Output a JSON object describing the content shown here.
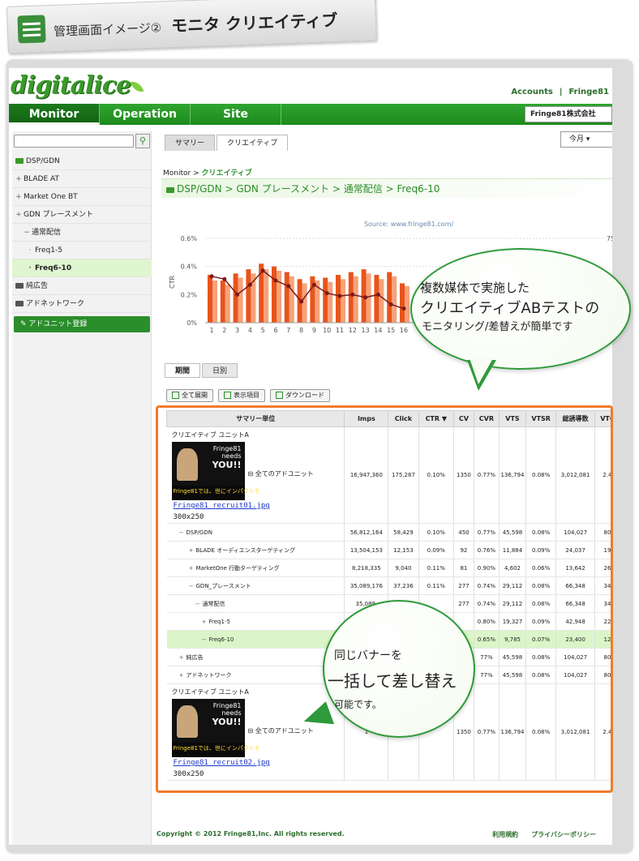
{
  "banner": {
    "prefix": "管理画面イメージ②",
    "title": "モニタ クリエイティブ"
  },
  "logo": "digitalice",
  "account_links": [
    "Accounts",
    "|",
    "Fringe81"
  ],
  "nav": [
    "Monitor",
    "Operation",
    "Site"
  ],
  "company": "Fringe81株式会社",
  "sidebar": {
    "items": [
      {
        "label": "DSP/GDN",
        "kind": "folder-green"
      },
      {
        "label": "BLADE AT",
        "kind": "plus"
      },
      {
        "label": "Market One BT",
        "kind": "plus"
      },
      {
        "label": "GDN プレースメント",
        "kind": "plus"
      },
      {
        "label": "通常配信",
        "kind": "minus"
      },
      {
        "label": "Freq1-5",
        "kind": "dot"
      },
      {
        "label": "Freq6-10",
        "kind": "dot-sel"
      },
      {
        "label": "純広告",
        "kind": "folder"
      },
      {
        "label": "アドネットワーク",
        "kind": "folder"
      }
    ],
    "register": "アドユニット登録"
  },
  "main_tabs": [
    "サマリー",
    "クリエイティブ"
  ],
  "period": "今月",
  "breadcrumb": {
    "root": "Monitor >",
    "current": "クリエイティブ"
  },
  "path": [
    "DSP/GDN",
    "GDN プレースメント",
    "通常配信",
    "Freq6-10"
  ],
  "chart_data": {
    "type": "bar",
    "source": "Source: www.fringe81.com/",
    "ylabel": "CTR",
    "yticks": [
      "0%",
      "0.2%",
      "0.4%",
      "0.6%"
    ],
    "ylim": [
      0,
      0.6
    ],
    "right_tick": "75",
    "categories": [
      "1",
      "2",
      "3",
      "4",
      "5",
      "6",
      "7",
      "8",
      "9",
      "10",
      "11",
      "12",
      "13",
      "14",
      "15",
      "16"
    ],
    "series": [
      {
        "values": [
          0.34,
          0.3,
          0.35,
          0.38,
          0.42,
          0.4,
          0.36,
          0.31,
          0.33,
          0.32,
          0.34,
          0.36,
          0.38,
          0.34,
          0.36,
          0.28
        ]
      },
      {
        "values": [
          0.3,
          0.27,
          0.32,
          0.35,
          0.38,
          0.37,
          0.33,
          0.28,
          0.3,
          0.29,
          0.31,
          0.33,
          0.35,
          0.31,
          0.33,
          0.26
        ]
      }
    ],
    "line": [
      0.33,
      0.31,
      0.2,
      0.27,
      0.37,
      0.3,
      0.26,
      0.15,
      0.27,
      0.21,
      0.19,
      0.2,
      0.18,
      0.2,
      0.13,
      0.1
    ]
  },
  "period_tabs": [
    "期間",
    "日別"
  ],
  "tools": [
    "全て展開",
    "表示項目",
    "ダウンロード"
  ],
  "table": {
    "headers": [
      "サマリー単位",
      "Imps",
      "Click",
      "CTR ▼",
      "CV",
      "CVR",
      "VTS",
      "VTSR",
      "総誘導数",
      "VTC"
    ],
    "creative1": {
      "label": "クリエイティブ ユニットA",
      "file": "Fringe81_recruit01.jpg",
      "size": "300x250",
      "unit": "全てのアドユニット",
      "values": [
        "16,947,360",
        "175,287",
        "0.10%",
        "1350",
        "0.77%",
        "136,794",
        "0.08%",
        "3,012,081",
        "2.4"
      ]
    },
    "rows": [
      {
        "name": "DSP/GDN",
        "pm": "−",
        "values": [
          "56,812,164",
          "58,429",
          "0.10%",
          "450",
          "0.77%",
          "45,598",
          "0.08%",
          "104,027",
          "80"
        ]
      },
      {
        "name": "BLADE オーディエンスターゲティング",
        "pm": "+",
        "values": [
          "13,504,153",
          "12,153",
          "0.09%",
          "92",
          "0.76%",
          "11,884",
          "0.09%",
          "24,037",
          "19"
        ]
      },
      {
        "name": "MarketOne 行動ターゲティング",
        "pm": "+",
        "values": [
          "8,218,335",
          "9,040",
          "0.11%",
          "81",
          "0.90%",
          "4,602",
          "0.06%",
          "13,642",
          "26"
        ]
      },
      {
        "name": "GDN_プレースメント",
        "pm": "−",
        "values": [
          "35,089,176",
          "37,236",
          "0.11%",
          "277",
          "0.74%",
          "29,112",
          "0.08%",
          "66,348",
          "34"
        ]
      },
      {
        "name": "通常配信",
        "pm": "−",
        "values": [
          "35,089,",
          "",
          "",
          "277",
          "0.74%",
          "29,112",
          "0.08%",
          "66,348",
          "34"
        ]
      },
      {
        "name": "Freq1-5",
        "pm": "+",
        "values": [
          "",
          "",
          "",
          "",
          "0.80%",
          "19,327",
          "0.09%",
          "42,948",
          "22"
        ]
      },
      {
        "name": "Freq6-10",
        "pm": "−",
        "hl": true,
        "values": [
          "",
          "",
          "",
          "",
          "0.65%",
          "9,785",
          "0.07%",
          "23,400",
          "12"
        ]
      },
      {
        "name": "純広告",
        "pm": "+",
        "values": [
          "",
          "",
          "",
          "",
          "77%",
          "45,598",
          "0.08%",
          "104,027",
          "80"
        ]
      },
      {
        "name": "アドネットワーク",
        "pm": "+",
        "values": [
          "",
          "",
          "",
          "",
          "77%",
          "45,598",
          "0.08%",
          "104,027",
          "80"
        ]
      }
    ],
    "creative2": {
      "label": "クリエイティブ ユニットA",
      "file": "Fringe81_recruit02.jpg",
      "size": "300x250",
      "unit": "全てのアドユニット",
      "values": [
        "1",
        "",
        "",
        "1350",
        "0.77%",
        "136,794",
        "0.08%",
        "3,012,081",
        "2.4"
      ]
    }
  },
  "banner_ad": {
    "l1": "Fringe81",
    "l2": "needs",
    "l3": "YOU!!",
    "small": "Fringe81では、世にインパクトを"
  },
  "footer": {
    "copyright": "Copyright © 2012 Fringe81,Inc. All rights reserved.",
    "links": [
      "利用規約",
      "プライバシーポリシー"
    ]
  },
  "callout1": {
    "l1": "複数媒体で実施した",
    "l2": "クリエイティブABテストの",
    "l3": "モニタリング/差替えが簡単です"
  },
  "callout2": {
    "l1": "同じバナーを",
    "l2": "一括して差し替え",
    "l3": "可能です。"
  },
  "colors": {
    "green": "#2a8e2a",
    "orange": "#f07b2e",
    "bar_dark": "#e8541b",
    "bar_light": "#f6a27a",
    "line": "#7a1a1a"
  }
}
